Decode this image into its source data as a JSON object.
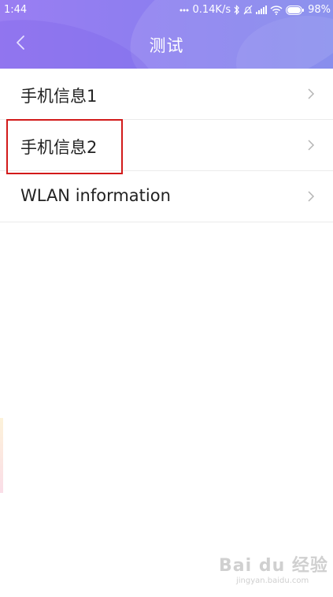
{
  "status_bar": {
    "time": "1:44",
    "network_speed": "0.14K/s",
    "battery": "98%",
    "icons": [
      "dots-icon",
      "bluetooth-icon",
      "alarm-off-icon",
      "signal-icon",
      "wifi-icon",
      "battery-icon"
    ]
  },
  "header": {
    "title": "测试",
    "back_icon": "chevron-left-icon"
  },
  "list": {
    "items": [
      {
        "label": "手机信息1"
      },
      {
        "label": "手机信息2"
      },
      {
        "label": "WLAN information"
      }
    ]
  },
  "watermark": {
    "logo": "Bai du 经验",
    "url": "jingyan.baidu.com"
  },
  "colors": {
    "header_start": "#9a7ef2",
    "header_end": "#7f86ec",
    "highlight": "#d21a1a",
    "item_text": "#222222",
    "divider": "#ebebeb",
    "chevron": "#b5b5b5"
  }
}
